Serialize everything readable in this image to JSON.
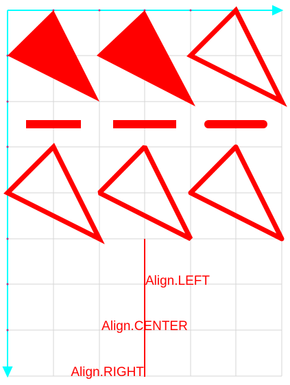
{
  "colors": {
    "background": "#ffffff",
    "grid": "#d6d6d6",
    "axis": "#00ffff",
    "shape": "#ff0000"
  },
  "labels": {
    "left": "Align.LEFT",
    "center": "Align.CENTER",
    "right": "Align.RIGHT"
  }
}
